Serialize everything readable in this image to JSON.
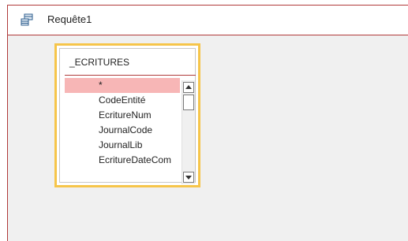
{
  "window": {
    "title": "Requête1",
    "icon": "query-design-icon"
  },
  "table": {
    "name": "_ECRITURES",
    "fields": [
      {
        "label": "*",
        "selected": true
      },
      {
        "label": "CodeEntité",
        "selected": false
      },
      {
        "label": "EcritureNum",
        "selected": false
      },
      {
        "label": "JournalCode",
        "selected": false
      },
      {
        "label": "JournalLib",
        "selected": false
      },
      {
        "label": "EcritureDateCom",
        "selected": false
      }
    ]
  },
  "scrollbar": {
    "up_icon": "scroll-up-arrow-icon",
    "down_icon": "scroll-down-arrow-icon"
  },
  "colors": {
    "accent_border": "#b03a3a",
    "selection_fill": "#f7b6b6",
    "table_highlight": "#f6c54a",
    "canvas_bg": "#f0f0f0"
  }
}
